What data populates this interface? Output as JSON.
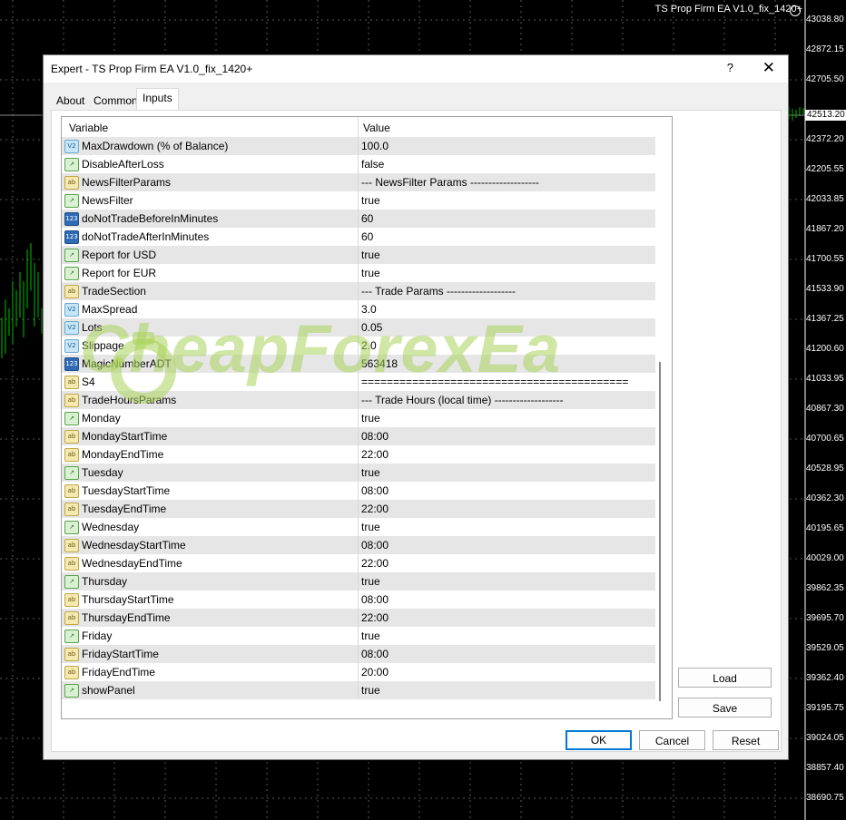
{
  "chart": {
    "title": "TS Prop Firm EA V1.0_fix_1420+",
    "current_price": "42513.20",
    "prices": [
      "43038.80",
      "42872.15",
      "42705.50",
      "42372.20",
      "42205.55",
      "42033.85",
      "41867.20",
      "41700.55",
      "41533.90",
      "41367.25",
      "41200.60",
      "41033.95",
      "40867.30",
      "40700.65",
      "40528.95",
      "40362.30",
      "40195.65",
      "40029.00",
      "39862.35",
      "39695.70",
      "39529.05",
      "39362.40",
      "39195.75",
      "39024.05",
      "38857.40",
      "38690.75"
    ]
  },
  "dialog": {
    "title": "Expert - TS Prop Firm EA V1.0_fix_1420+",
    "help": "?",
    "close": "✕",
    "tabs": [
      "About",
      "Common",
      "Inputs"
    ],
    "active_tab": "Inputs",
    "columns": {
      "variable": "Variable",
      "value": "Value"
    },
    "rows": [
      {
        "icon": "dbl",
        "var": "MaxDrawdown (% of Balance)",
        "val": "100.0"
      },
      {
        "icon": "bool",
        "var": "DisableAfterLoss",
        "val": "false"
      },
      {
        "icon": "str",
        "var": "NewsFilterParams",
        "val": "--- NewsFilter Params -------------------"
      },
      {
        "icon": "bool",
        "var": "NewsFilter",
        "val": "true"
      },
      {
        "icon": "int",
        "var": "doNotTradeBeforeInMinutes",
        "val": "60"
      },
      {
        "icon": "int",
        "var": "doNotTradeAfterInMinutes",
        "val": "60"
      },
      {
        "icon": "bool",
        "var": "Report for USD",
        "val": "true"
      },
      {
        "icon": "bool",
        "var": "Report for EUR",
        "val": "true"
      },
      {
        "icon": "str",
        "var": "TradeSection",
        "val": "--- Trade Params -------------------"
      },
      {
        "icon": "dbl",
        "var": "MaxSpread",
        "val": "3.0"
      },
      {
        "icon": "dbl",
        "var": "Lots",
        "val": "0.05"
      },
      {
        "icon": "dbl",
        "var": "Slippage",
        "val": "2.0"
      },
      {
        "icon": "int",
        "var": "MagicNumberADT",
        "val": "563418"
      },
      {
        "icon": "str",
        "var": "S4",
        "val": "=========================================="
      },
      {
        "icon": "str",
        "var": "TradeHoursParams",
        "val": "--- Trade Hours  (local time) -------------------"
      },
      {
        "icon": "bool",
        "var": "Monday",
        "val": "true"
      },
      {
        "icon": "str",
        "var": "MondayStartTime",
        "val": "08:00"
      },
      {
        "icon": "str",
        "var": "MondayEndTime",
        "val": "22:00"
      },
      {
        "icon": "bool",
        "var": "Tuesday",
        "val": "true"
      },
      {
        "icon": "str",
        "var": "TuesdayStartTime",
        "val": "08:00"
      },
      {
        "icon": "str",
        "var": "TuesdayEndTime",
        "val": "22:00"
      },
      {
        "icon": "bool",
        "var": "Wednesday",
        "val": "true"
      },
      {
        "icon": "str",
        "var": "WednesdayStartTime",
        "val": "08:00"
      },
      {
        "icon": "str",
        "var": "WednesdayEndTime",
        "val": "22:00"
      },
      {
        "icon": "bool",
        "var": "Thursday",
        "val": "true"
      },
      {
        "icon": "str",
        "var": "ThursdayStartTime",
        "val": "08:00"
      },
      {
        "icon": "str",
        "var": "ThursdayEndTime",
        "val": "22:00"
      },
      {
        "icon": "bool",
        "var": "Friday",
        "val": "true"
      },
      {
        "icon": "str",
        "var": "FridayStartTime",
        "val": "08:00"
      },
      {
        "icon": "str",
        "var": "FridayEndTime",
        "val": "20:00"
      },
      {
        "icon": "bool",
        "var": "showPanel",
        "val": "true"
      }
    ],
    "icon_labels": {
      "dbl": "V2",
      "bool": "↗",
      "str": "ab",
      "int": "123"
    },
    "buttons": {
      "load": "Load",
      "save": "Save",
      "ok": "OK",
      "cancel": "Cancel",
      "reset": "Reset"
    }
  },
  "watermark": {
    "text": "CheapForexEa"
  },
  "colors": {
    "accent": "#0078d7",
    "row_alt": "#e6e6e6",
    "chart_bg": "#000000",
    "candle": "#00c000"
  }
}
